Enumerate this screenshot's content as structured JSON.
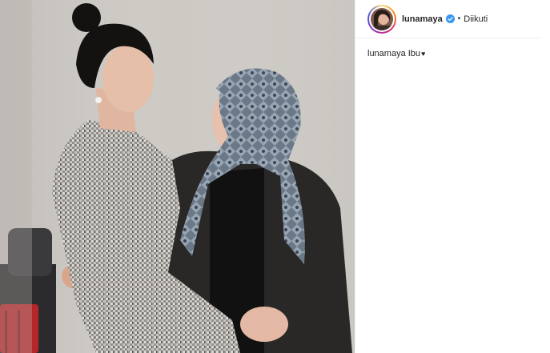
{
  "post": {
    "photo_alt": "",
    "author": {
      "username": "lunamaya",
      "verified": true,
      "follow_status": "Diikuti",
      "separator": "•"
    },
    "caption": {
      "username": "lunamaya",
      "text": "Ibu",
      "emoji": "♥"
    }
  },
  "colors": {
    "wall": "#cdc9c4",
    "verified_blue": "#3897f0",
    "text": "#262626"
  }
}
